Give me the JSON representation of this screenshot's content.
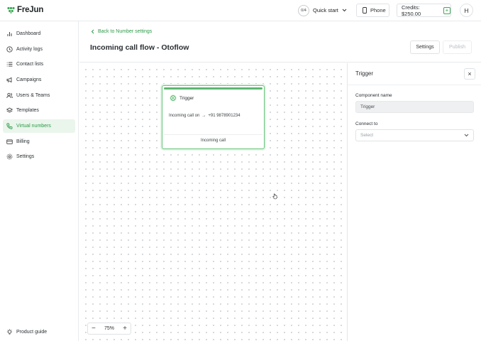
{
  "app": {
    "name": "FreJun",
    "brand_color": "#2c9a47"
  },
  "topbar": {
    "quick_start_progress": "0/4",
    "quick_start_label": "Quick start",
    "phone_label": "Phone",
    "credits_label": "Credits: $250.00",
    "add_credits_symbol": "+",
    "avatar_initial": "H"
  },
  "sidebar": {
    "items": [
      {
        "label": "Dashboard",
        "icon": "bar-chart-icon"
      },
      {
        "label": "Activity logs",
        "icon": "clock-icon"
      },
      {
        "label": "Contact lists",
        "icon": "list-icon"
      },
      {
        "label": "Campaigns",
        "icon": "megaphone-icon"
      },
      {
        "label": "Users & Teams",
        "icon": "users-icon"
      },
      {
        "label": "Templates",
        "icon": "layers-icon"
      },
      {
        "label": "Virtual numbers",
        "icon": "phone-icon",
        "active": true
      },
      {
        "label": "Billing",
        "icon": "card-icon"
      },
      {
        "label": "Settings",
        "icon": "gear-icon"
      }
    ],
    "product_guide_label": "Product guide"
  },
  "header": {
    "back_link": "Back to Number settings",
    "title": "Incoming call flow - Otoflow",
    "settings_button": "Settings",
    "publish_button": "Publish"
  },
  "canvas": {
    "node": {
      "title": "Trigger",
      "body_prefix": "Incoming call on",
      "arrow": "→",
      "number": "+91 9878901234",
      "footer": "Incoming call"
    },
    "zoom": {
      "minus": "−",
      "level": "75%",
      "plus": "+"
    }
  },
  "panel": {
    "title": "Trigger",
    "close": "×",
    "component_name_label": "Component name",
    "component_name_value": "Trigger",
    "connect_to_label": "Connect to",
    "connect_to_placeholder": "Select"
  }
}
